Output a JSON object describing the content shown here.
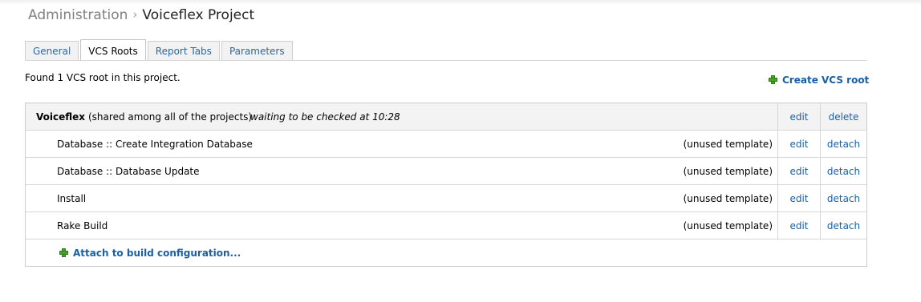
{
  "breadcrumb": {
    "parent": "Administration",
    "separator": "›",
    "current": "Voiceflex Project"
  },
  "tabs": [
    {
      "label": "General",
      "active": false
    },
    {
      "label": "VCS Roots",
      "active": true
    },
    {
      "label": "Report Tabs",
      "active": false
    },
    {
      "label": "Parameters",
      "active": false
    }
  ],
  "summary_text": "Found 1 VCS root in this project.",
  "create_vcs_root_label": "Create VCS root",
  "vcs_root": {
    "name": "Voiceflex",
    "shared_note": "(shared among all of the projects)",
    "status": "waiting to be checked at 10:28",
    "edit_label": "edit",
    "delete_label": "delete"
  },
  "configurations": [
    {
      "name": "Database :: Create Integration Database",
      "note": "(unused template)",
      "edit_label": "edit",
      "detach_label": "detach"
    },
    {
      "name": "Database :: Database Update",
      "note": "(unused template)",
      "edit_label": "edit",
      "detach_label": "detach"
    },
    {
      "name": "Install",
      "note": "(unused template)",
      "edit_label": "edit",
      "detach_label": "detach"
    },
    {
      "name": "Rake Build",
      "note": "(unused template)",
      "edit_label": "edit",
      "detach_label": "detach"
    }
  ],
  "attach_label": "Attach to build configuration...",
  "colors": {
    "link": "#1a5fa8",
    "plus_icon": "#4aa02c",
    "header_row_bg": "#f3f3f3"
  },
  "icons": {
    "create": "plus-icon",
    "attach": "plus-icon"
  }
}
